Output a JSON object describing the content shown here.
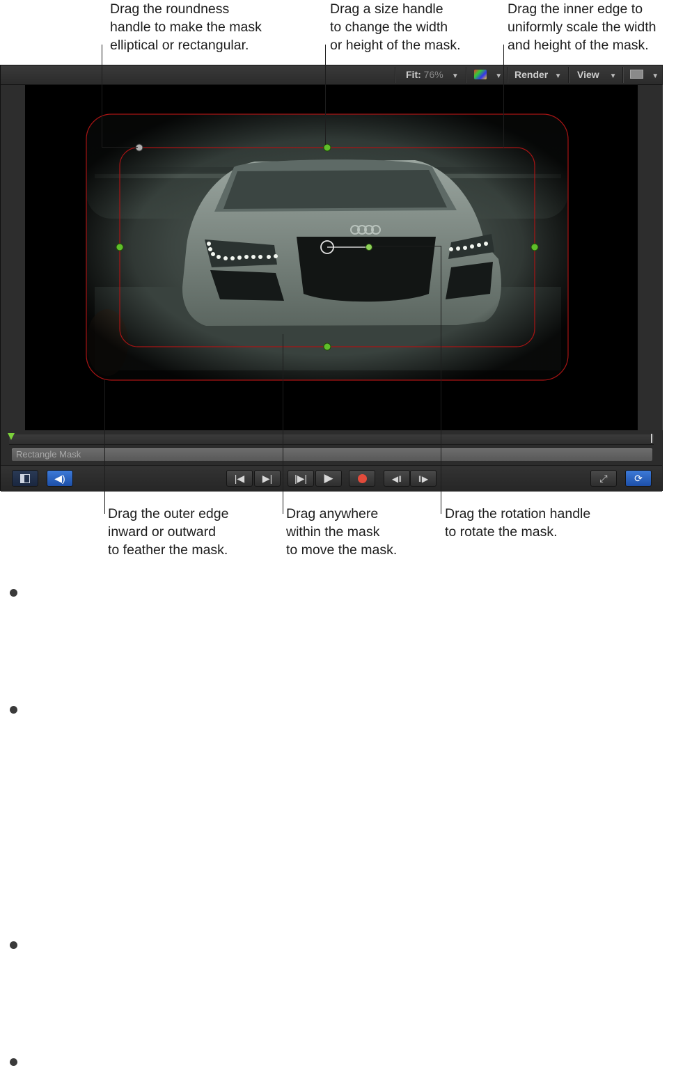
{
  "callouts": {
    "roundness": "Drag the roundness\nhandle to make the mask\nelliptical or rectangular.",
    "size_handle": "Drag a size handle\nto change the width\nor height of the mask.",
    "inner_edge": "Drag the inner edge to\nuniformly scale the width\nand height of the mask.",
    "outer_edge": "Drag the outer edge\ninward or outward\nto feather the mask.",
    "anywhere": "Drag anywhere\nwithin the mask\nto move the mask.",
    "rotation": "Drag the rotation handle\nto rotate the mask."
  },
  "toolbar": {
    "fit_label": "Fit:",
    "fit_value": "76%",
    "render_label": "Render",
    "view_label": "View"
  },
  "timeline": {
    "mask_bar_label": "Rectangle Mask"
  },
  "colors": {
    "handle_green": "#5fbf2a",
    "mask_outline": "#b01818",
    "accent_blue": "#2a62c4"
  },
  "icons": [
    "play-icon",
    "record-icon",
    "go-to-start-icon",
    "go-to-end-icon",
    "fullscreen-icon",
    "loop-icon",
    "audio-icon",
    "sidebar-toggle-icon"
  ]
}
